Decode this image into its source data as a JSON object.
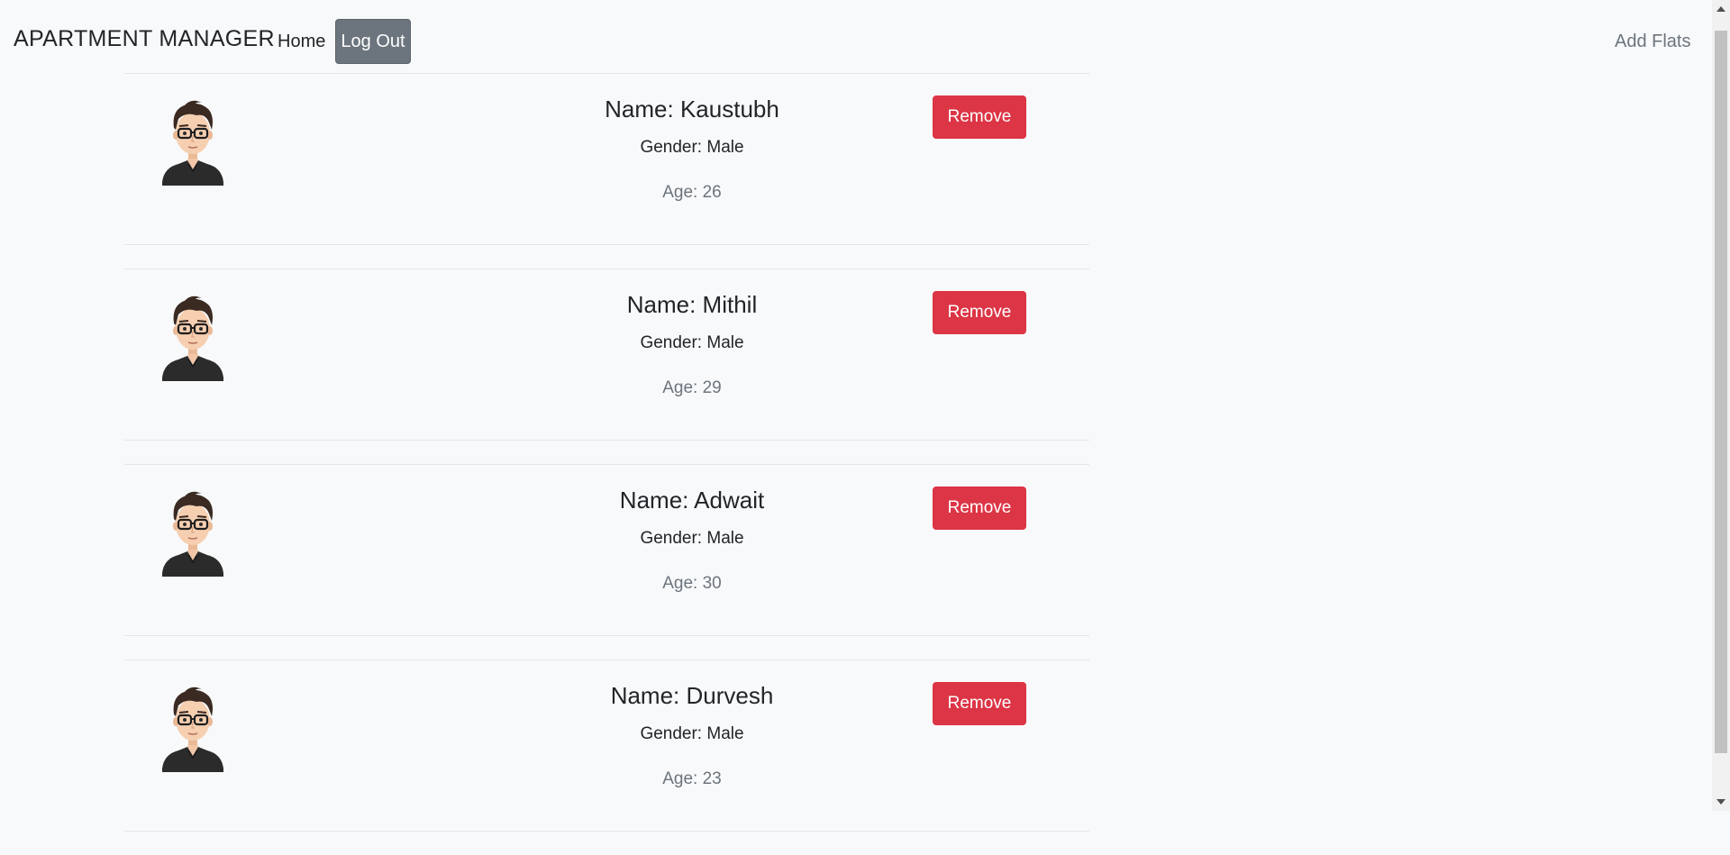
{
  "navbar": {
    "brand": "APARTMENT MANAGER",
    "home_label": "Home",
    "logout_label": "Log Out",
    "add_flats_label": "Add Flats"
  },
  "residents": [
    {
      "name": "Name: Kaustubh",
      "gender": "Gender: Male",
      "age": "Age: 26",
      "remove_label": "Remove"
    },
    {
      "name": "Name: Mithil",
      "gender": "Gender: Male",
      "age": "Age: 29",
      "remove_label": "Remove"
    },
    {
      "name": "Name: Adwait",
      "gender": "Gender: Male",
      "age": "Age: 30",
      "remove_label": "Remove"
    },
    {
      "name": "Name: Durvesh",
      "gender": "Gender: Male",
      "age": "Age: 23",
      "remove_label": "Remove"
    }
  ],
  "colors": {
    "danger": "#dc3545",
    "secondary": "#6c757d",
    "background": "#f8f9fa"
  },
  "icons": {
    "avatar": "user-avatar-icon"
  }
}
